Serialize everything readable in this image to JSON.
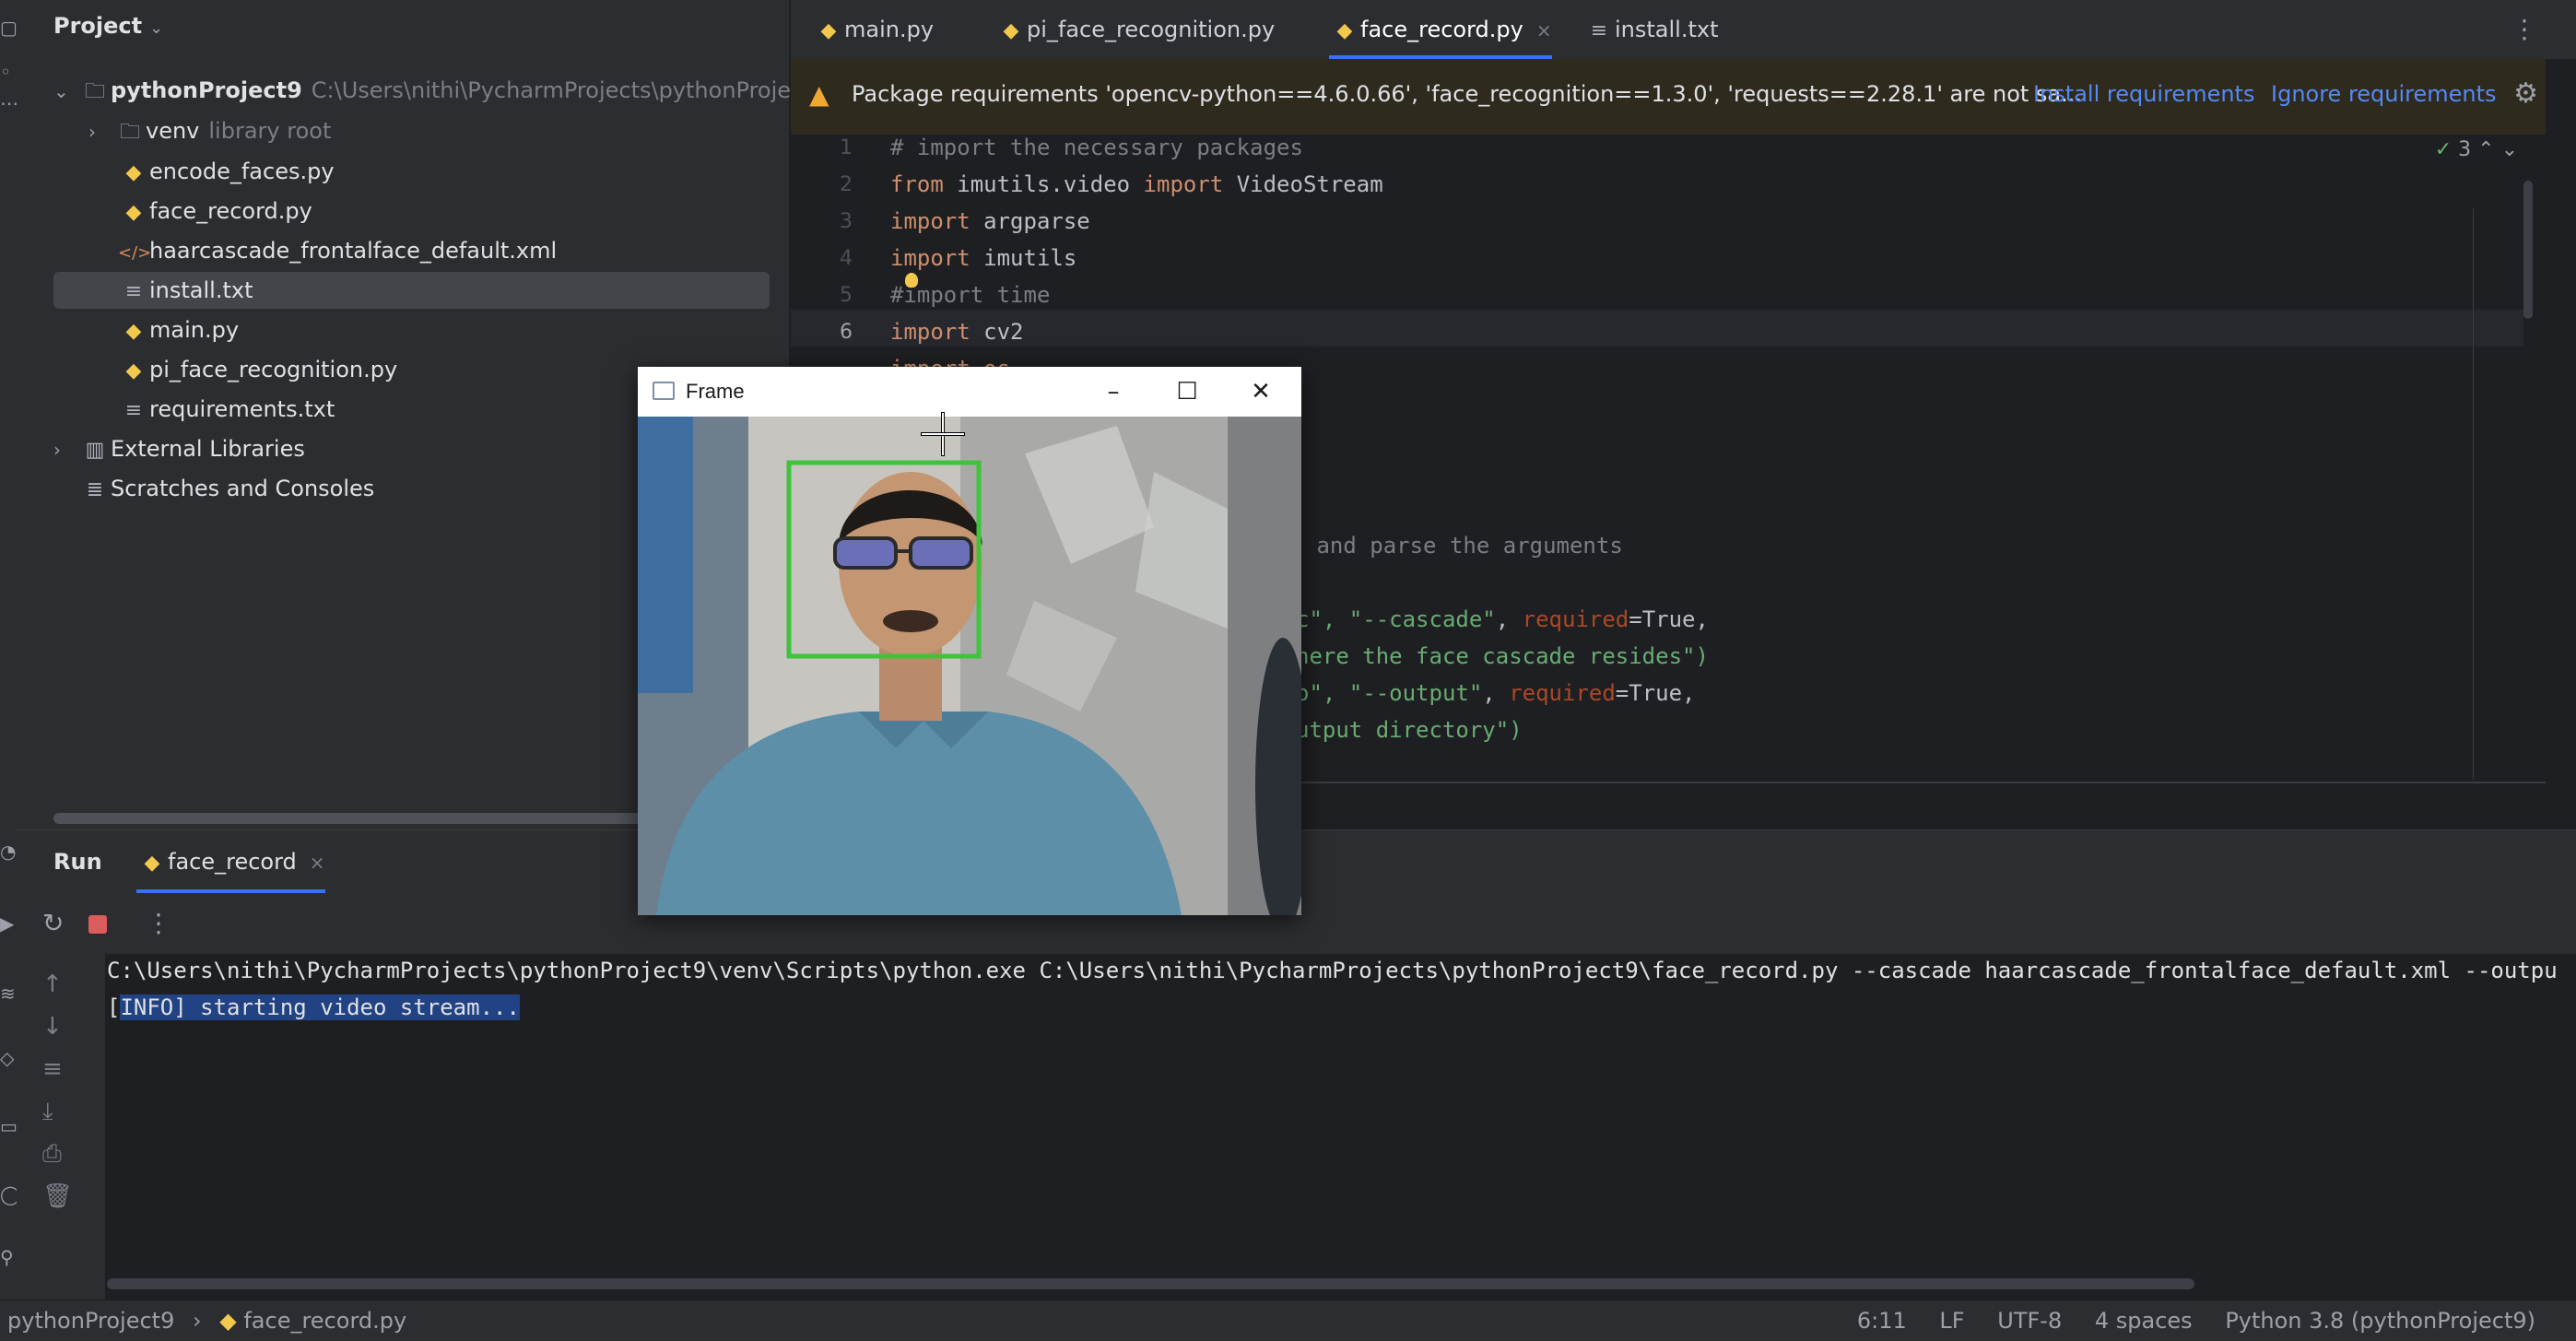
{
  "project": {
    "title": "Project",
    "tree": {
      "root_name": "pythonProject9",
      "root_path": "C:\\Users\\nithi\\PycharmProjects\\pythonProject9",
      "venv_name": "venv",
      "venv_hint": "library root",
      "files": [
        "encode_faces.py",
        "face_record.py",
        "haarcascade_frontalface_default.xml",
        "install.txt",
        "main.py",
        "pi_face_recognition.py",
        "requirements.txt"
      ],
      "external_libraries": "External Libraries",
      "scratches": "Scratches and Consoles"
    }
  },
  "editor_tabs": [
    "main.py",
    "pi_face_recognition.py",
    "face_record.py",
    "install.txt"
  ],
  "active_tab": "face_record.py",
  "banner": {
    "message": "Package requirements 'opencv-python==4.6.0.66', 'face_recognition==1.3.0', 'requests==2.28.1' are not sa...",
    "install": "Install requirements",
    "ignore": "Ignore requirements"
  },
  "inspection_count": "3",
  "code": {
    "line_numbers": [
      "1",
      "2",
      "3",
      "4",
      "5",
      "6"
    ],
    "line1": "# import the necessary packages",
    "line2_from": "from",
    "line2_mod": " imutils.video ",
    "line2_import": "import",
    "line2_name": " VideoStream",
    "line3_kw": "import",
    "line3_name": " argparse",
    "line4_kw": "import",
    "line4_name": " imutils",
    "line5": "#import time",
    "line6_kw": "import",
    "line6_name": " cv2",
    "line7": "import os",
    "frag_parse": " and parse the arguments",
    "frag_a1": "c\", ",
    "frag_a2": "\"--cascade\"",
    "frag_a3": ", ",
    "frag_a4": "required",
    "frag_a5": "=True,",
    "frag_b": "here the face cascade resides\")",
    "frag_c1": "o\", ",
    "frag_c2": "\"--output\"",
    "frag_c3": ", ",
    "frag_c4": "required",
    "frag_c5": "=True,",
    "frag_d": "utput directory\")"
  },
  "run": {
    "title": "Run",
    "tab": "face_record",
    "command": "C:\\Users\\nithi\\PycharmProjects\\pythonProject9\\venv\\Scripts\\python.exe C:\\Users\\nithi\\PycharmProjects\\pythonProject9\\face_record.py --cascade haarcascade_frontalface_default.xml --outpu",
    "info_open": "[",
    "info_sel": "INFO] starting video stream..."
  },
  "frame_window": {
    "title": "Frame"
  },
  "status": {
    "project": "pythonProject9",
    "file": "face_record.py",
    "position": "6:11",
    "line_sep": "LF",
    "encoding": "UTF-8",
    "indent": "4 spaces",
    "interpreter": "Python 3.8 (pythonProject9)"
  },
  "colors": {
    "accent": "#3574f0",
    "face_box": "#3ec43a",
    "warning": "#f0a732"
  }
}
